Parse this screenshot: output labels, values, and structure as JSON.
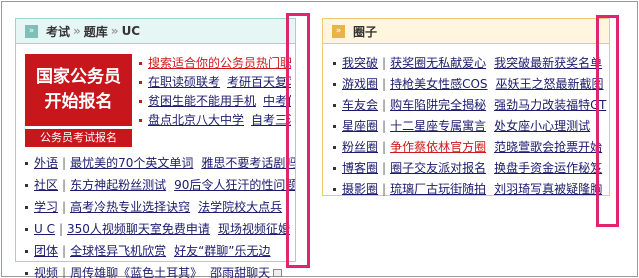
{
  "left_panel": {
    "tabs": [
      "考试",
      "题库",
      "UC"
    ],
    "separator": "»",
    "promo": {
      "line1": "国家公务员",
      "line2": "开始报名",
      "caption": "公务员考试报名"
    },
    "feature_links": [
      {
        "items": [
          "搜索适合你的公务员热门职位"
        ],
        "red": true
      },
      {
        "items": [
          "在职读硕联考",
          "考研百天复习计"
        ]
      },
      {
        "items": [
          "贫困生能不能用手机",
          "中考作文"
        ]
      },
      {
        "items": [
          "盘点北京八大中学",
          "自考三注意"
        ]
      }
    ],
    "rows": [
      {
        "category": "外语",
        "links": [
          "最忧美的70个英文单词",
          "雅思不要考话剧吗"
        ]
      },
      {
        "category": "社区",
        "links": [
          "东方神起粉丝测试",
          "90后令人狂汗的性问题"
        ]
      },
      {
        "category": "学习",
        "links": [
          "高考冷热专业选择诀窍",
          "法学院校大点兵"
        ]
      },
      {
        "category": "U C",
        "links": [
          "350人视频聊天室免费申请",
          "现场视频征婚"
        ]
      },
      {
        "category": "团体",
        "links": [
          "全球怪异飞机欣赏",
          "好友“群聊”乐无边"
        ]
      },
      {
        "category": "视频",
        "links": [
          "周传雄聊《蓝色土耳其》",
          "邵雨甜聊天"
        ]
      }
    ]
  },
  "right_panel": {
    "title": "圈子",
    "rows": [
      {
        "category": "我突破",
        "links": [
          "获奖圈无私献爱心",
          "我突破最新获奖名单"
        ]
      },
      {
        "category": "游戏圈",
        "links": [
          "持枪美女性感COS",
          "巫妖王之怒最新截图"
        ]
      },
      {
        "category": "车友会",
        "links": [
          "购车陷阱完全揭秘",
          "强劲马力改装福特GT"
        ]
      },
      {
        "category": "星座圈",
        "links": [
          "十二星座专属寓言",
          "处女座小心理测试"
        ]
      },
      {
        "category": "粉丝圈",
        "links": [
          "争作蔡依林官方圈",
          "范晓萱歌会抢票开始"
        ],
        "red_first": true
      },
      {
        "category": "博客圈",
        "links": [
          "圈子交友派对报名",
          "换盘手资金运作秘笈"
        ]
      },
      {
        "category": "摄影圈",
        "links": [
          "琉璃厂古玩街随拍",
          "刘羽琦写真被疑隆胸"
        ]
      }
    ]
  },
  "colors": {
    "accent_red": "#c7171c",
    "link_blue": "#1c1c6e",
    "left_border": "#9fd3ce",
    "right_border": "#f0c976",
    "highlight": "#e0246e"
  },
  "icons": [
    "panel-toggle-icon",
    "panel-toggle-icon",
    "video-icon"
  ]
}
